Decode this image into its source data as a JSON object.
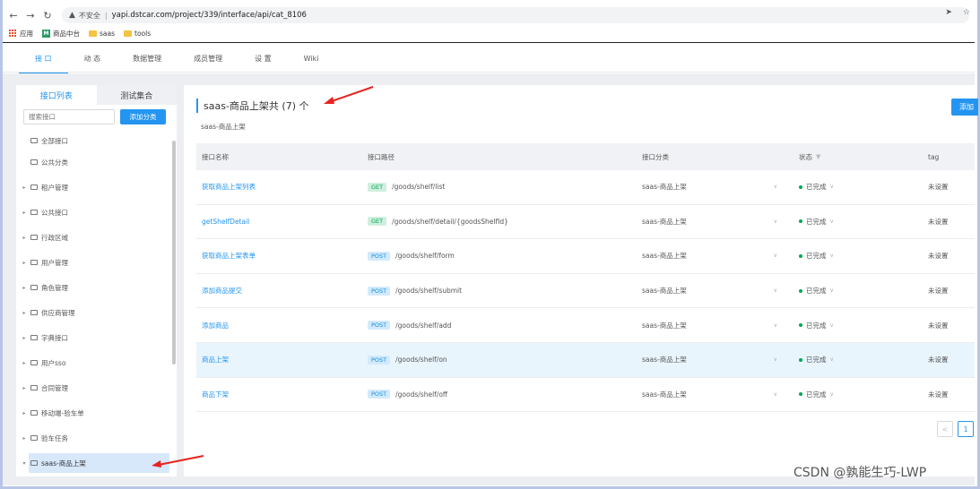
{
  "browser": {
    "insecure_label": "不安全",
    "url": "yapi.dstcar.com/project/339/interface/api/cat_8106",
    "bookmarks": [
      {
        "label": "应用",
        "icon": "apps-grid-icon"
      },
      {
        "label": "商品中台",
        "icon": "site-logo-icon"
      },
      {
        "label": "saas",
        "icon": "folder-icon"
      },
      {
        "label": "tools",
        "icon": "folder-icon"
      }
    ]
  },
  "app_nav": {
    "tabs": [
      {
        "label": "接 口",
        "active": true
      },
      {
        "label": "动 态",
        "active": false
      },
      {
        "label": "数据管理",
        "active": false
      },
      {
        "label": "成员管理",
        "active": false
      },
      {
        "label": "设 置",
        "active": false
      },
      {
        "label": "Wiki",
        "active": false
      }
    ]
  },
  "sidebar": {
    "tab_api_list": "接口列表",
    "tab_test_collection": "测试集合",
    "search_placeholder": "搜索接口",
    "add_category_label": "添加分类",
    "categories": [
      {
        "label": "全部接口",
        "has_children": false
      },
      {
        "label": "公共分类",
        "has_children": false
      },
      {
        "label": "租户管理",
        "has_children": true
      },
      {
        "label": "公共接口",
        "has_children": true
      },
      {
        "label": "行政区域",
        "has_children": true
      },
      {
        "label": "用户管理",
        "has_children": true
      },
      {
        "label": "角色管理",
        "has_children": true
      },
      {
        "label": "供应商管理",
        "has_children": true
      },
      {
        "label": "字典接口",
        "has_children": true
      },
      {
        "label": "用户sso",
        "has_children": true
      },
      {
        "label": "合同管理",
        "has_children": true
      },
      {
        "label": "移动端-验车单",
        "has_children": true
      },
      {
        "label": "验车任务",
        "has_children": true
      },
      {
        "label": "saas-商品上架",
        "has_children": true,
        "selected": true
      }
    ]
  },
  "main": {
    "title": "saas-商品上架共 (7) 个",
    "subtitle": "saas-商品上架",
    "add_button_label": "添加",
    "columns": [
      "接口名称",
      "接口路径",
      "接口分类",
      "状态",
      "tag"
    ],
    "rows": [
      {
        "name": "获取商品上架列表",
        "method": "GET",
        "path": "/goods/shelf/list",
        "category": "saas-商品上架",
        "status": "已完成",
        "tag": "未设置"
      },
      {
        "name": "getShelfDetail",
        "method": "GET",
        "path": "/goods/shelf/detail/{goodsShelfId}",
        "category": "saas-商品上架",
        "status": "已完成",
        "tag": "未设置"
      },
      {
        "name": "获取商品上架表单",
        "method": "POST",
        "path": "/goods/shelf/form",
        "category": "saas-商品上架",
        "status": "已完成",
        "tag": "未设置"
      },
      {
        "name": "添加商品提交",
        "method": "POST",
        "path": "/goods/shelf/submit",
        "category": "saas-商品上架",
        "status": "已完成",
        "tag": "未设置"
      },
      {
        "name": "添加商品",
        "method": "POST",
        "path": "/goods/shelf/add",
        "category": "saas-商品上架",
        "status": "已完成",
        "tag": "未设置"
      },
      {
        "name": "商品上架",
        "method": "POST",
        "path": "/goods/shelf/on",
        "category": "saas-商品上架",
        "status": "已完成",
        "tag": "未设置"
      },
      {
        "name": "商品下架",
        "method": "POST",
        "path": "/goods/shelf/off",
        "category": "saas-商品上架",
        "status": "已完成",
        "tag": "未设置"
      }
    ],
    "pager": {
      "prev": "<",
      "current": "1"
    }
  },
  "watermark": "CSDN @孰能生巧-LWP",
  "colors": {
    "accent": "#2395f1",
    "annotation_arrow": "#e8231f",
    "get_badge": "#00a854",
    "post_badge": "#108ee9"
  }
}
